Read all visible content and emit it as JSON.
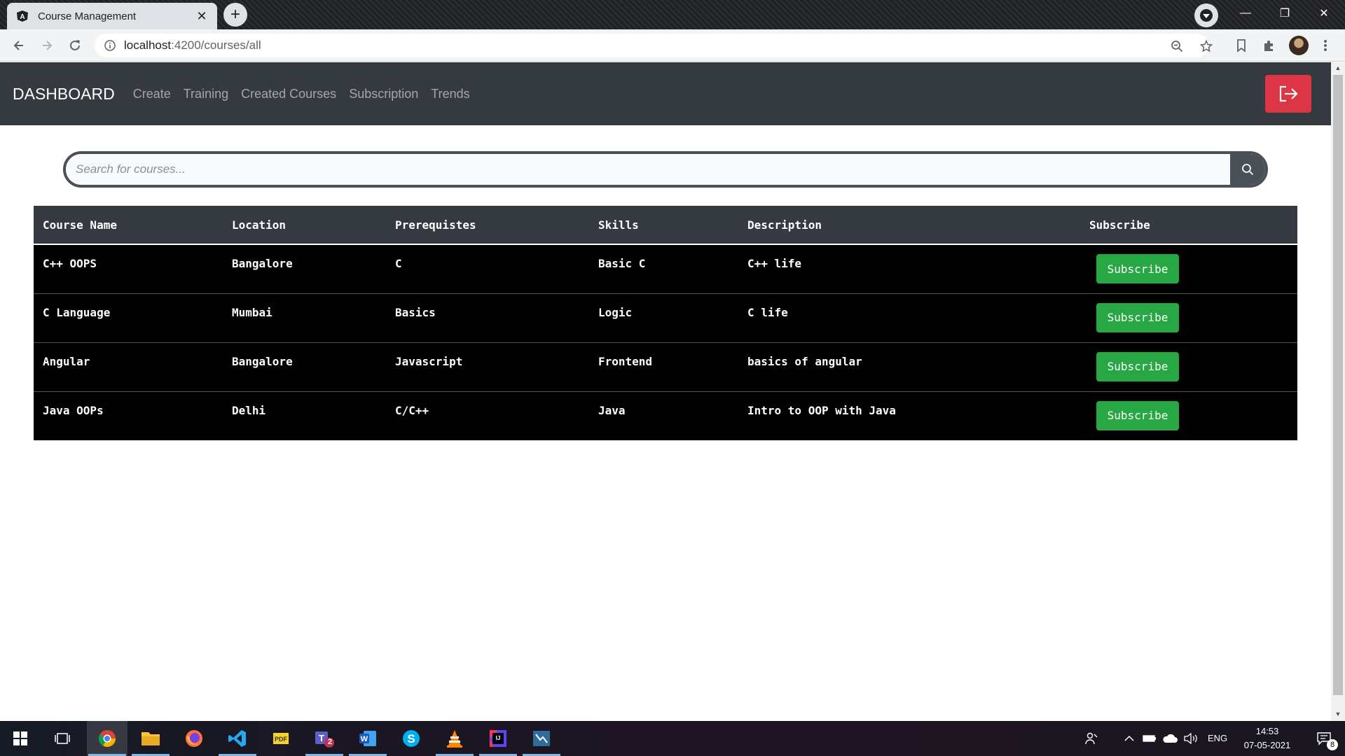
{
  "browser": {
    "tab_title": "Course Management",
    "url_host": "localhost",
    "url_rest": ":4200/courses/all"
  },
  "navbar": {
    "brand": "DASHBOARD",
    "links": [
      "Create",
      "Training",
      "Created Courses",
      "Subscription",
      "Trends"
    ]
  },
  "search": {
    "placeholder": "Search for courses..."
  },
  "table": {
    "headers": [
      "Course Name",
      "Location",
      "Prerequistes",
      "Skills",
      "Description",
      "Subscribe"
    ],
    "rows": [
      {
        "name": "C++ OOPS",
        "location": "Bangalore",
        "prereq": "C",
        "skills": "Basic C",
        "description": "C++ life",
        "action": "Subscribe"
      },
      {
        "name": "C Language",
        "location": "Mumbai",
        "prereq": "Basics",
        "skills": "Logic",
        "description": "C life",
        "action": "Subscribe"
      },
      {
        "name": "Angular",
        "location": "Bangalore",
        "prereq": "Javascript",
        "skills": "Frontend",
        "description": "basics of angular",
        "action": "Subscribe"
      },
      {
        "name": "Java OOPs",
        "location": "Delhi",
        "prereq": "C/C++",
        "skills": "Java",
        "description": "Intro to OOP with Java",
        "action": "Subscribe"
      }
    ]
  },
  "taskbar": {
    "language": "ENG",
    "time": "14:53",
    "date": "07-05-2021",
    "notification_count": "8",
    "teams_badge": "2"
  },
  "colors": {
    "navbar_bg": "#343a40",
    "logout_red": "#dc3545",
    "subscribe_green": "#28a745"
  }
}
